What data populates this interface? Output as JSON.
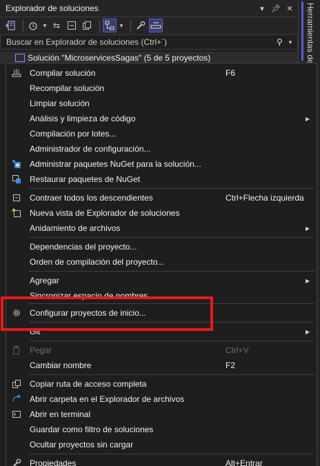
{
  "window": {
    "title": "Explorador de soluciones",
    "side_tab_label": "Herramientas de diagnóstico"
  },
  "search": {
    "placeholder": "Buscar en Explorador de soluciones (Ctrl+´)"
  },
  "solution": {
    "label": "Solución \"MicroservicesSagas\"  (5 de 5 proyectos)"
  },
  "menu": {
    "compilar": {
      "label": "Compilar solución",
      "shortcut": "F6"
    },
    "recompilar": {
      "label": "Recompilar solución"
    },
    "limpiar": {
      "label": "Limpiar solución"
    },
    "analisis": {
      "label": "Análisis y limpieza de código"
    },
    "lotes": {
      "label": "Compilación por lotes..."
    },
    "admin_config": {
      "label": "Administrador de configuración..."
    },
    "nuget": {
      "label": "Administrar paquetes NuGet para la solución..."
    },
    "restaurar": {
      "label": "Restaurar paquetes de NuGet"
    },
    "contraer": {
      "label": "Contraer todos los descendientes",
      "shortcut": "Ctrl+Flecha izquierda"
    },
    "nueva_vista": {
      "label": "Nueva vista de Explorador de soluciones"
    },
    "anidamiento": {
      "label": "Anidamiento de archivos"
    },
    "dependencias": {
      "label": "Dependencias del proyecto..."
    },
    "orden": {
      "label": "Orden de compilación del proyecto..."
    },
    "agregar": {
      "label": "Agregar"
    },
    "sincronizar": {
      "label": "Sincronizar espacio de nombres"
    },
    "configurar": {
      "label": "Configurar proyectos de inicio..."
    },
    "git": {
      "label": "Git"
    },
    "pegar": {
      "label": "Pegar",
      "shortcut": "Ctrl+V"
    },
    "cambiar": {
      "label": "Cambiar nombre",
      "shortcut": "F2"
    },
    "copiar_ruta": {
      "label": "Copiar ruta de acceso completa"
    },
    "abrir_carpeta": {
      "label": "Abrir carpeta en el Explorador de archivos"
    },
    "terminal": {
      "label": "Abrir en terminal"
    },
    "guardar_filtro": {
      "label": "Guardar como filtro de soluciones"
    },
    "ocultar": {
      "label": "Ocultar proyectos sin cargar"
    },
    "propiedades": {
      "label": "Propiedades",
      "shortcut": "Alt+Entrar"
    }
  },
  "colors": {
    "background": "#1f1f1f",
    "accent": "#5b5bd6",
    "highlight_box": "#e8191d"
  }
}
